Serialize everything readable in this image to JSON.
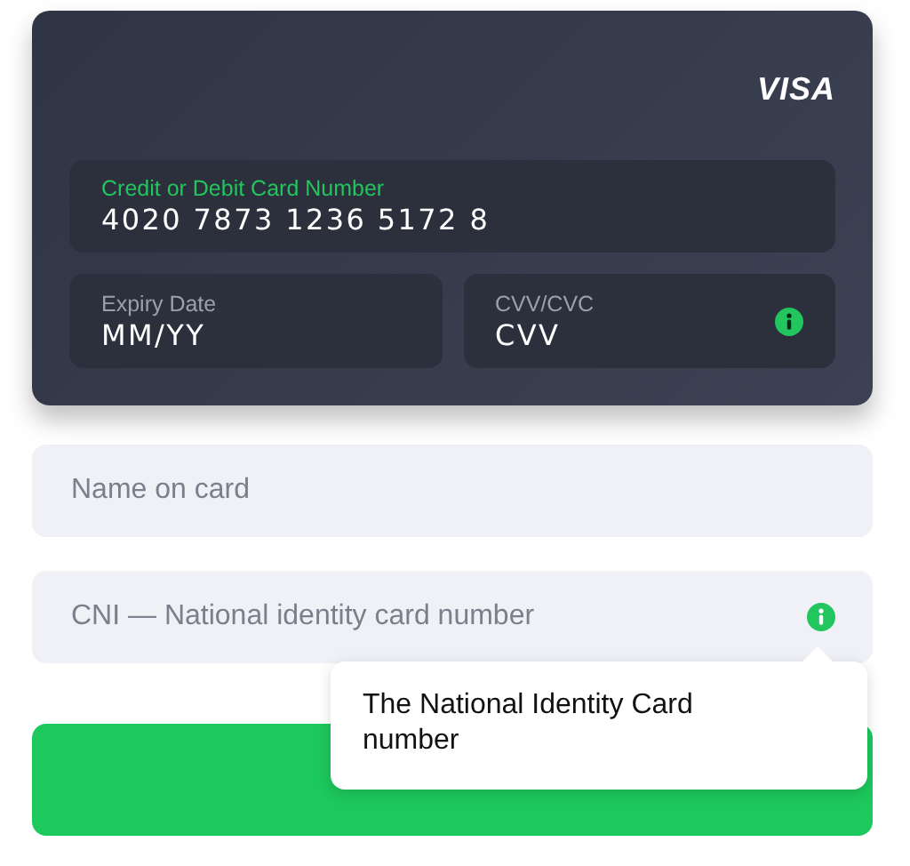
{
  "card": {
    "brand": "VISA",
    "number_field": {
      "label": "Credit or Debit Card Number",
      "value": "4020 7873 1236 5172 8",
      "focused": true
    },
    "expiry_field": {
      "label": "Expiry Date",
      "value": "MM/YY",
      "focused": false
    },
    "cvv_field": {
      "label": "CVV/CVC",
      "value": "CVV",
      "focused": false
    }
  },
  "name_field": {
    "placeholder": "Name on card"
  },
  "cni_field": {
    "placeholder": "CNI — National identity card number"
  },
  "tooltip": {
    "text": "The National Identity Card number"
  }
}
